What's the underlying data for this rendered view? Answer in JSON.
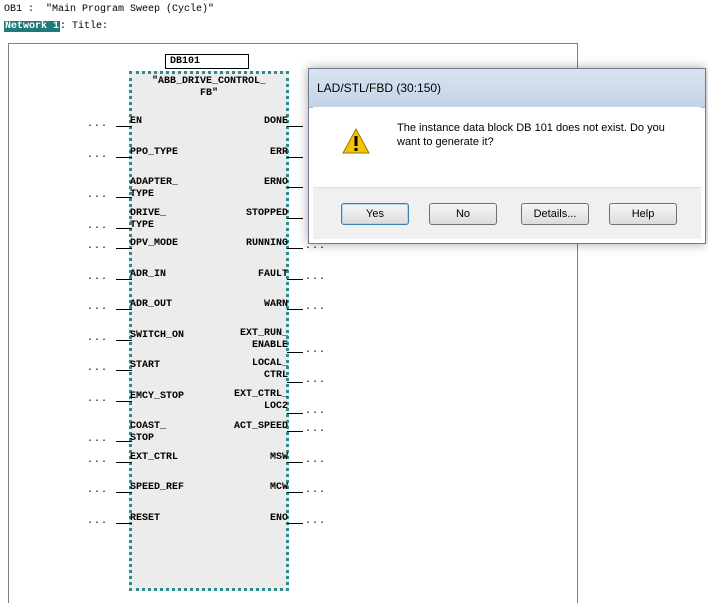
{
  "header": {
    "ob_line": "OB1 :  \"Main Program Sweep (Cycle)\"",
    "network_badge": "Network 1",
    "network_title": ": Title:"
  },
  "block": {
    "instance_db": "DB101",
    "fb_name_line1": "\"ABB_DRIVE_CONTROL_",
    "fb_name_line2": "FB\"",
    "inputs": [
      {
        "l1": "EN",
        "l2": ""
      },
      {
        "l1": "PPO_TYPE",
        "l2": ""
      },
      {
        "l1": "ADAPTER_",
        "l2": "TYPE"
      },
      {
        "l1": "DRIVE_",
        "l2": "TYPE"
      },
      {
        "l1": "DPV_MODE",
        "l2": ""
      },
      {
        "l1": "ADR_IN",
        "l2": ""
      },
      {
        "l1": "ADR_OUT",
        "l2": ""
      },
      {
        "l1": "SWITCH_ON",
        "l2": ""
      },
      {
        "l1": "START",
        "l2": ""
      },
      {
        "l1": "EMCY_STOP",
        "l2": ""
      },
      {
        "l1": "COAST_",
        "l2": "STOP"
      },
      {
        "l1": "EXT_CTRL",
        "l2": ""
      },
      {
        "l1": "SPEED_REF",
        "l2": ""
      },
      {
        "l1": "RESET",
        "l2": ""
      }
    ],
    "outputs": [
      {
        "l1": "DONE",
        "l2": ""
      },
      {
        "l1": "ERR",
        "l2": ""
      },
      {
        "l1": "ERNO",
        "l2": ""
      },
      {
        "l1": "STOPPED",
        "l2": ""
      },
      {
        "l1": "RUNNING",
        "l2": ""
      },
      {
        "l1": "FAULT",
        "l2": ""
      },
      {
        "l1": "WARN",
        "l2": ""
      },
      {
        "l1": "EXT_RUN_",
        "l2": "ENABLE"
      },
      {
        "l1": "LOCAL_",
        "l2": "CTRL"
      },
      {
        "l1": "EXT_CTRL_",
        "l2": "LOC2"
      },
      {
        "l1": "ACT_SPEED",
        "l2": ""
      },
      {
        "l1": "MSW",
        "l2": ""
      },
      {
        "l1": "MCW",
        "l2": ""
      },
      {
        "l1": "ENO",
        "l2": ""
      }
    ],
    "connector_dots": "..."
  },
  "dialog": {
    "title": "LAD/STL/FBD  (30:150)",
    "message": "The instance data block DB 101 does not exist. Do you want to generate it?",
    "buttons": {
      "yes": "Yes",
      "no": "No",
      "details": "Details...",
      "help": "Help"
    },
    "icon": "warning-icon"
  },
  "colors": {
    "network_badge_bg": "#1f7a7a",
    "block_border": "#2e8b8b",
    "block_fill": "#ececec"
  }
}
